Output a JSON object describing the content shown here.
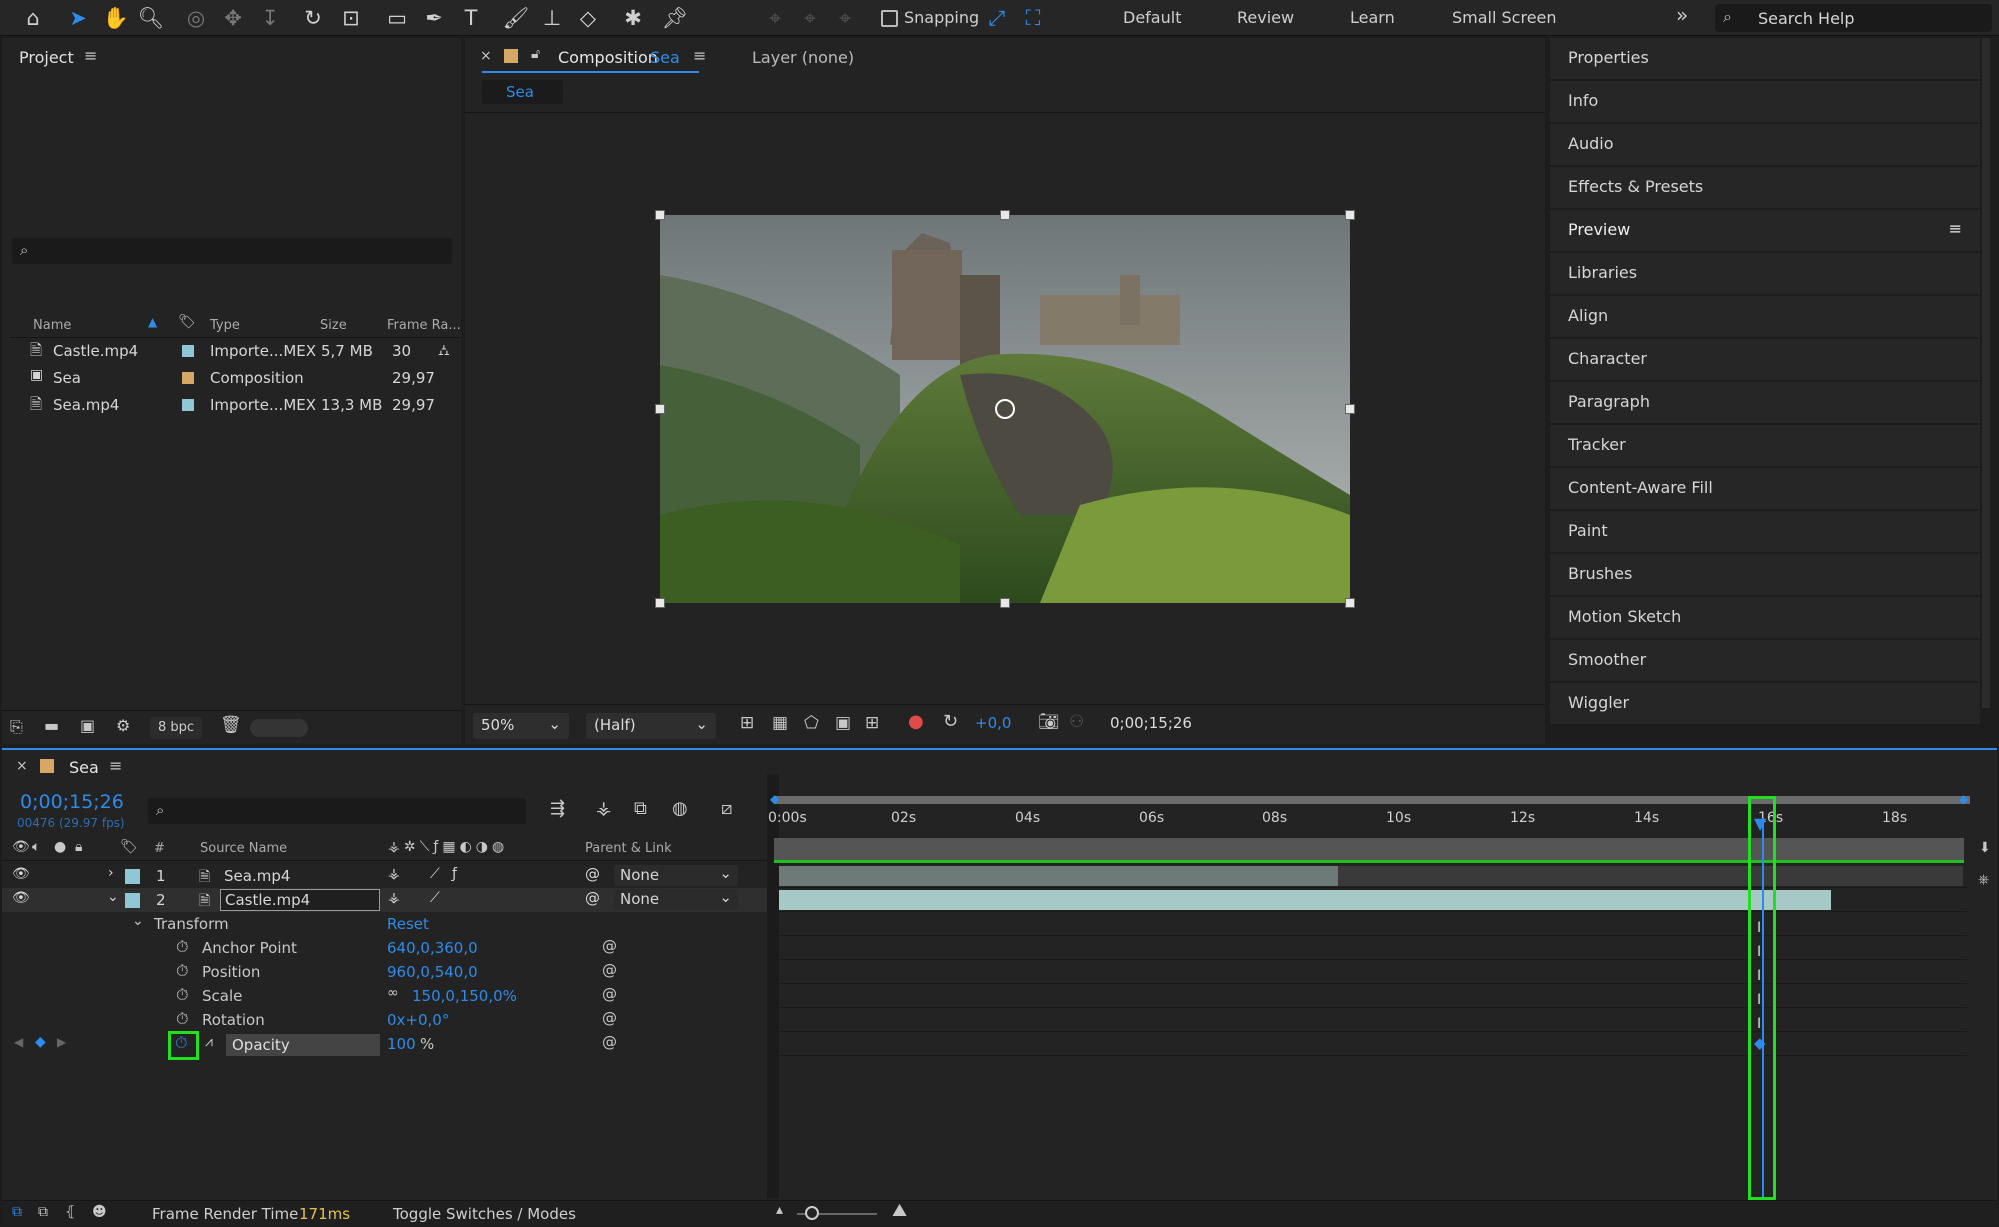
{
  "toolbar": {
    "snapping_label": "Snapping",
    "workspaces": [
      "Default",
      "Review",
      "Learn",
      "Small Screen"
    ],
    "more": "»",
    "search_placeholder": "Search Help"
  },
  "project": {
    "title": "Project",
    "columns": [
      "Name",
      "Type",
      "Size",
      "Frame Ra..."
    ],
    "items": [
      {
        "name": "Castle.mp4",
        "type": "Importe...MEX",
        "size": "5,7 MB",
        "frame_rate": "30",
        "label_color": "#8fc7d6"
      },
      {
        "name": "Sea",
        "type": "Composition",
        "size": "",
        "frame_rate": "29,97",
        "label_color": "#d7a766"
      },
      {
        "name": "Sea.mp4",
        "type": "Importe...MEX",
        "size": "13,3 MB",
        "frame_rate": "29,97",
        "label_color": "#8fc7d6"
      }
    ],
    "bpc": "8 bpc"
  },
  "composition": {
    "tab_prefix": "Composition",
    "tab_name": "Sea",
    "layer_tab": "Layer (none)",
    "subtab": "Sea",
    "zoom": "50%",
    "resolution": "(Half)",
    "exposure": "+0,0",
    "timecode": "0;00;15;26"
  },
  "right_panels": [
    "Properties",
    "Info",
    "Audio",
    "Effects & Presets",
    "Preview",
    "Libraries",
    "Align",
    "Character",
    "Paragraph",
    "Tracker",
    "Content-Aware Fill",
    "Paint",
    "Brushes",
    "Motion Sketch",
    "Smoother",
    "Wiggler"
  ],
  "timeline": {
    "comp_name": "Sea",
    "timecode": "0;00;15;26",
    "frame_info": "00476 (29.97 fps)",
    "column_hash": "#",
    "column_source": "Source Name",
    "column_parent": "Parent & Link",
    "layers": [
      {
        "index": "1",
        "name": "Sea.mp4",
        "parent": "None"
      },
      {
        "index": "2",
        "name": "Castle.mp4",
        "parent": "None"
      }
    ],
    "transform_label": "Transform",
    "reset_label": "Reset",
    "properties": [
      {
        "name": "Anchor Point",
        "value": "640,0,360,0"
      },
      {
        "name": "Position",
        "value": "960,0,540,0"
      },
      {
        "name": "Scale",
        "value": "150,0,150,0%"
      },
      {
        "name": "Rotation",
        "value": "0x+0,0°"
      },
      {
        "name": "Opacity",
        "value": "100",
        "unit": "%"
      }
    ],
    "ruler_labels": [
      "0:00s",
      "02s",
      "04s",
      "06s",
      "08s",
      "10s",
      "12s",
      "14s",
      "16s",
      "18s"
    ],
    "footer_render_label": "Frame Render Time",
    "footer_render_value": "171ms",
    "footer_toggle": "Toggle Switches / Modes"
  },
  "colors": {
    "accent": "#2d8ceb",
    "highlight": "#21e021",
    "bar_sea": "#6e7a78",
    "bar_castle": "#a7c9c6"
  }
}
